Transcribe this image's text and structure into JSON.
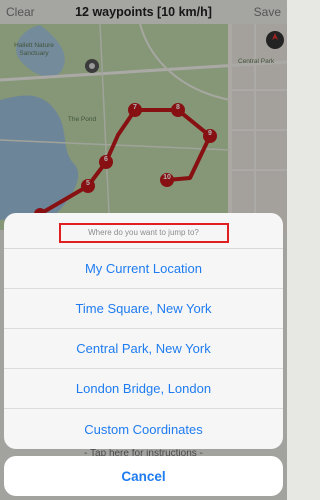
{
  "navbar": {
    "clear_label": "Clear",
    "title": "12 waypoints [10 km/h]",
    "save_label": "Save"
  },
  "map": {
    "labels": {
      "sanctuary": "Hallett Nature\nSanctuary",
      "pond": "The Pond",
      "central_park": "Central Park"
    },
    "waypoints": [
      "5",
      "6",
      "7",
      "8",
      "9",
      "10"
    ],
    "route_color": "#c2181b",
    "water_color": "#93b8d8",
    "park_color": "#bcd7a9"
  },
  "sheet": {
    "prompt": "Where do you want to jump to?",
    "options": [
      "My Current Location",
      "Time Square, New York",
      "Central Park, New York",
      "London Bridge, London",
      "Custom Coordinates"
    ]
  },
  "behind_text": "- Tap here for instructions -",
  "cancel_label": "Cancel",
  "colors": {
    "accent": "#1f7cf0",
    "highlight": "#e02020"
  }
}
